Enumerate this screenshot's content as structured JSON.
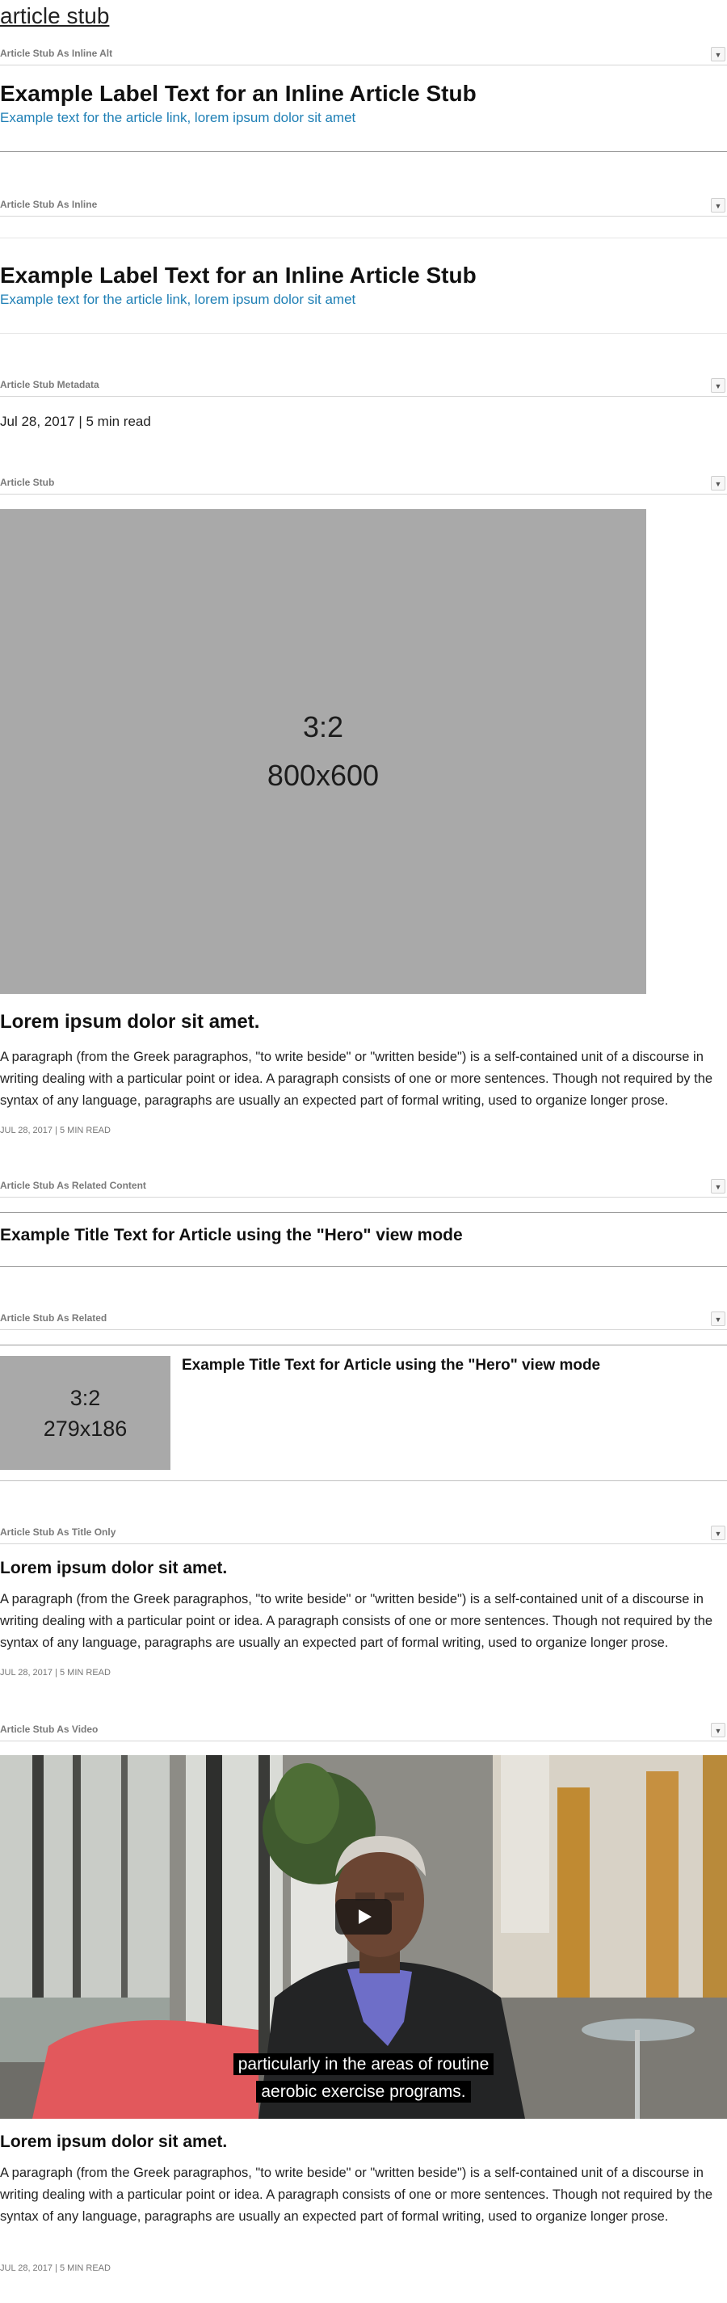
{
  "page": {
    "title": "article stub"
  },
  "toggle_glyph": "▼",
  "sections": {
    "inline_alt": {
      "label": "Article Stub As Inline Alt",
      "heading": "Example Label Text for an Inline Article Stub",
      "link": "Example text for the article link, lorem ipsum dolor sit amet"
    },
    "inline": {
      "label": "Article Stub As Inline",
      "heading": "Example Label Text for an Inline Article Stub",
      "link": "Example text for the article link, lorem ipsum dolor sit amet"
    },
    "metadata": {
      "label": "Article Stub Metadata",
      "text": "Jul 28, 2017 | 5 min read"
    },
    "stub": {
      "label": "Article Stub",
      "image_ratio": "3:2",
      "image_size": "800x600",
      "heading": "Lorem ipsum dolor sit amet.",
      "paragraph": "A paragraph (from the Greek paragraphos, \"to write beside\" or \"written beside\") is a self-contained unit of a discourse in writing dealing with a particular point or idea. A paragraph consists of one or more sentences. Though not required by the syntax of any language, paragraphs are usually an expected part of formal writing, used to organize longer prose.",
      "meta": "JUL 28, 2017 | 5 MIN READ"
    },
    "related_content": {
      "label": "Article Stub As Related Content",
      "title": "Example Title Text for Article using the \"Hero\" view mode"
    },
    "related": {
      "label": "Article Stub As Related",
      "image_ratio": "3:2",
      "image_size": "279x186",
      "title": "Example Title Text for Article using the \"Hero\" view mode"
    },
    "title_only": {
      "label": "Article Stub As Title Only",
      "heading": "Lorem ipsum dolor sit amet.",
      "paragraph": "A paragraph (from the Greek paragraphos, \"to write beside\" or \"written beside\") is a self-contained unit of a discourse in writing dealing with a particular point or idea. A paragraph consists of one or more sentences. Though not required by the syntax of any language, paragraphs are usually an expected part of formal writing, used to organize longer prose.",
      "meta": "JUL 28, 2017 | 5 MIN READ"
    },
    "video": {
      "label": "Article Stub As Video",
      "caption_line1": "particularly in the areas of routine",
      "caption_line2": "aerobic exercise programs.",
      "heading": "Lorem ipsum dolor sit amet.",
      "paragraph": "A paragraph (from the Greek paragraphos, \"to write beside\" or \"written beside\") is a self-contained unit of a discourse in writing dealing with a particular point or idea. A paragraph consists of one or more sentences. Though not required by the syntax of any language, paragraphs are usually an expected part of formal writing, used to organize longer prose.",
      "meta": "JUL 28, 2017 | 5 MIN READ"
    }
  },
  "colors": {
    "link": "#1e7fb5",
    "placeholder": "#a9a9a9",
    "section_label": "#7a7a7a"
  }
}
